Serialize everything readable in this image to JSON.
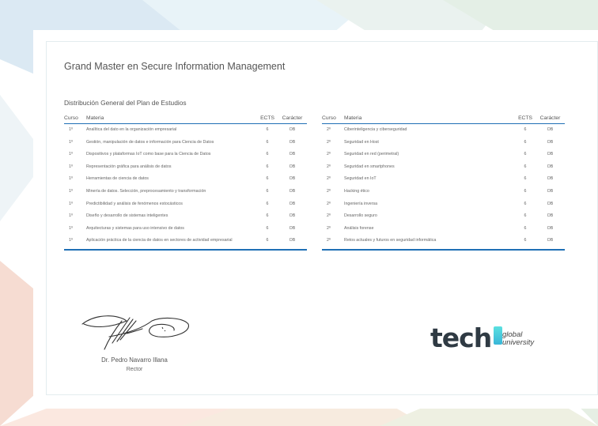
{
  "colors": {
    "accent": "#1f6fb5",
    "logo_accent": "#3ec9dc",
    "text": "#555555"
  },
  "certificate": {
    "title": "Grand Master en Secure Information Management",
    "subtitle": "Distribución General del Plan de Estudios"
  },
  "headers": {
    "curso": "Curso",
    "materia": "Materia",
    "ects": "ECTS",
    "caracter": "Carácter"
  },
  "left_rows": [
    {
      "curso": "1º",
      "materia": "Analítica del dato en la organización empresarial",
      "ects": "6",
      "caracter": "OB"
    },
    {
      "curso": "1º",
      "materia": "Gestión, manipulación de datos e información para Ciencia de Datos",
      "ects": "6",
      "caracter": "OB"
    },
    {
      "curso": "1º",
      "materia": "Dispositivos y plataformas IoT como base para la Ciencia de Datos",
      "ects": "6",
      "caracter": "OB"
    },
    {
      "curso": "1º",
      "materia": "Representación gráfica para análisis de datos",
      "ects": "6",
      "caracter": "OB"
    },
    {
      "curso": "1º",
      "materia": "Herramientas de ciencia de datos",
      "ects": "6",
      "caracter": "OB"
    },
    {
      "curso": "1º",
      "materia": "Minería de datos. Selección, preprocesamiento y transformación",
      "ects": "6",
      "caracter": "OB"
    },
    {
      "curso": "1º",
      "materia": "Predictibilidad y análisis de fenómenos estocásticos",
      "ects": "6",
      "caracter": "OB"
    },
    {
      "curso": "1º",
      "materia": "Diseño y desarrollo de sistemas inteligentes",
      "ects": "6",
      "caracter": "OB"
    },
    {
      "curso": "1º",
      "materia": "Arquitecturas y sistemas para uso intensivo de datos",
      "ects": "6",
      "caracter": "OB"
    },
    {
      "curso": "1º",
      "materia": "Aplicación práctica de la ciencia de datos en sectores de actividad empresarial",
      "ects": "6",
      "caracter": "OB"
    }
  ],
  "right_rows": [
    {
      "curso": "2º",
      "materia": "Ciberinteligencia y ciberseguridad",
      "ects": "6",
      "caracter": "OB"
    },
    {
      "curso": "2º",
      "materia": "Seguridad en Host",
      "ects": "6",
      "caracter": "OB"
    },
    {
      "curso": "2º",
      "materia": "Seguridad en red (perimetral)",
      "ects": "6",
      "caracter": "OB"
    },
    {
      "curso": "2º",
      "materia": "Seguridad en smartphones",
      "ects": "6",
      "caracter": "OB"
    },
    {
      "curso": "2º",
      "materia": "Seguridad en IoT",
      "ects": "6",
      "caracter": "OB"
    },
    {
      "curso": "2º",
      "materia": "Hacking ético",
      "ects": "6",
      "caracter": "OB"
    },
    {
      "curso": "2º",
      "materia": "Ingeniería inversa",
      "ects": "6",
      "caracter": "OB"
    },
    {
      "curso": "2º",
      "materia": "Desarrollo seguro",
      "ects": "6",
      "caracter": "OB"
    },
    {
      "curso": "2º",
      "materia": "Análisis forense",
      "ects": "6",
      "caracter": "OB"
    },
    {
      "curso": "2º",
      "materia": "Retos actuales y futuros en seguridad informática",
      "ects": "6",
      "caracter": "OB"
    }
  ],
  "signatory": {
    "name": "Dr. Pedro Navarro Illana",
    "role": "Rector"
  },
  "logo": {
    "word": "tech",
    "line1": "global",
    "line2": "university",
    "icon": "tech-logo"
  }
}
